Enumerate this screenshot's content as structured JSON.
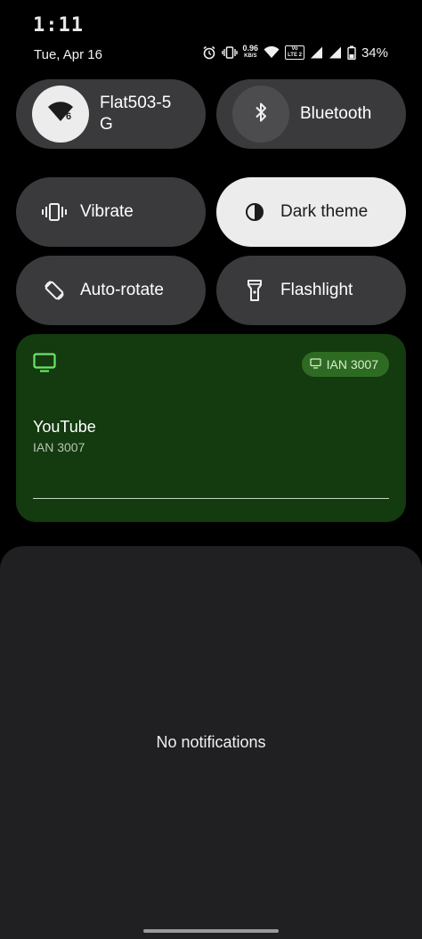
{
  "status_bar": {
    "time": "1:11",
    "date": "Tue, Apr 16",
    "net_speed_value": "0.96",
    "net_speed_unit": "KB/S",
    "volte_top": "Vo",
    "volte_bottom": "LTE 2",
    "battery_percent": "34%"
  },
  "quick_settings": {
    "internet": {
      "label": "Flat503-5 G",
      "badge": "6",
      "active": true
    },
    "bluetooth": {
      "label": "Bluetooth",
      "active": false
    },
    "vibrate": {
      "label": "Vibrate",
      "active": false
    },
    "dark_theme": {
      "label": "Dark theme",
      "active": true
    },
    "auto_rotate": {
      "label": "Auto-rotate",
      "active": false
    },
    "flashlight": {
      "label": "Flashlight",
      "active": false
    }
  },
  "media": {
    "app": "YouTube",
    "device": "IAN 3007",
    "device_chip": "IAN 3007",
    "accent": "#143a0f"
  },
  "notifications": {
    "empty_text": "No notifications"
  }
}
